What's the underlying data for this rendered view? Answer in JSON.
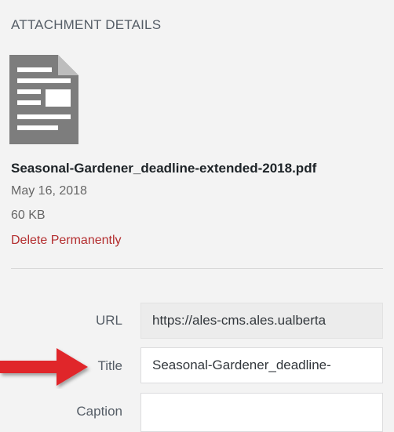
{
  "header": {
    "title": "ATTACHMENT DETAILS"
  },
  "file": {
    "icon": "document-icon",
    "name": "Seasonal-Gardener_deadline-extended-2018.pdf",
    "date": "May 16, 2018",
    "size": "60 KB",
    "delete_label": "Delete Permanently"
  },
  "fields": {
    "url": {
      "label": "URL",
      "value": "https://ales-cms.ales.ualberta"
    },
    "title": {
      "label": "Title",
      "value": "Seasonal-Gardener_deadline-"
    },
    "caption": {
      "label": "Caption",
      "value": ""
    }
  },
  "annotation": {
    "icon": "red-arrow-icon",
    "color": "#e0252b"
  },
  "colors": {
    "delete_link": "#b32d2e",
    "panel_bg": "#f3f3f3"
  }
}
